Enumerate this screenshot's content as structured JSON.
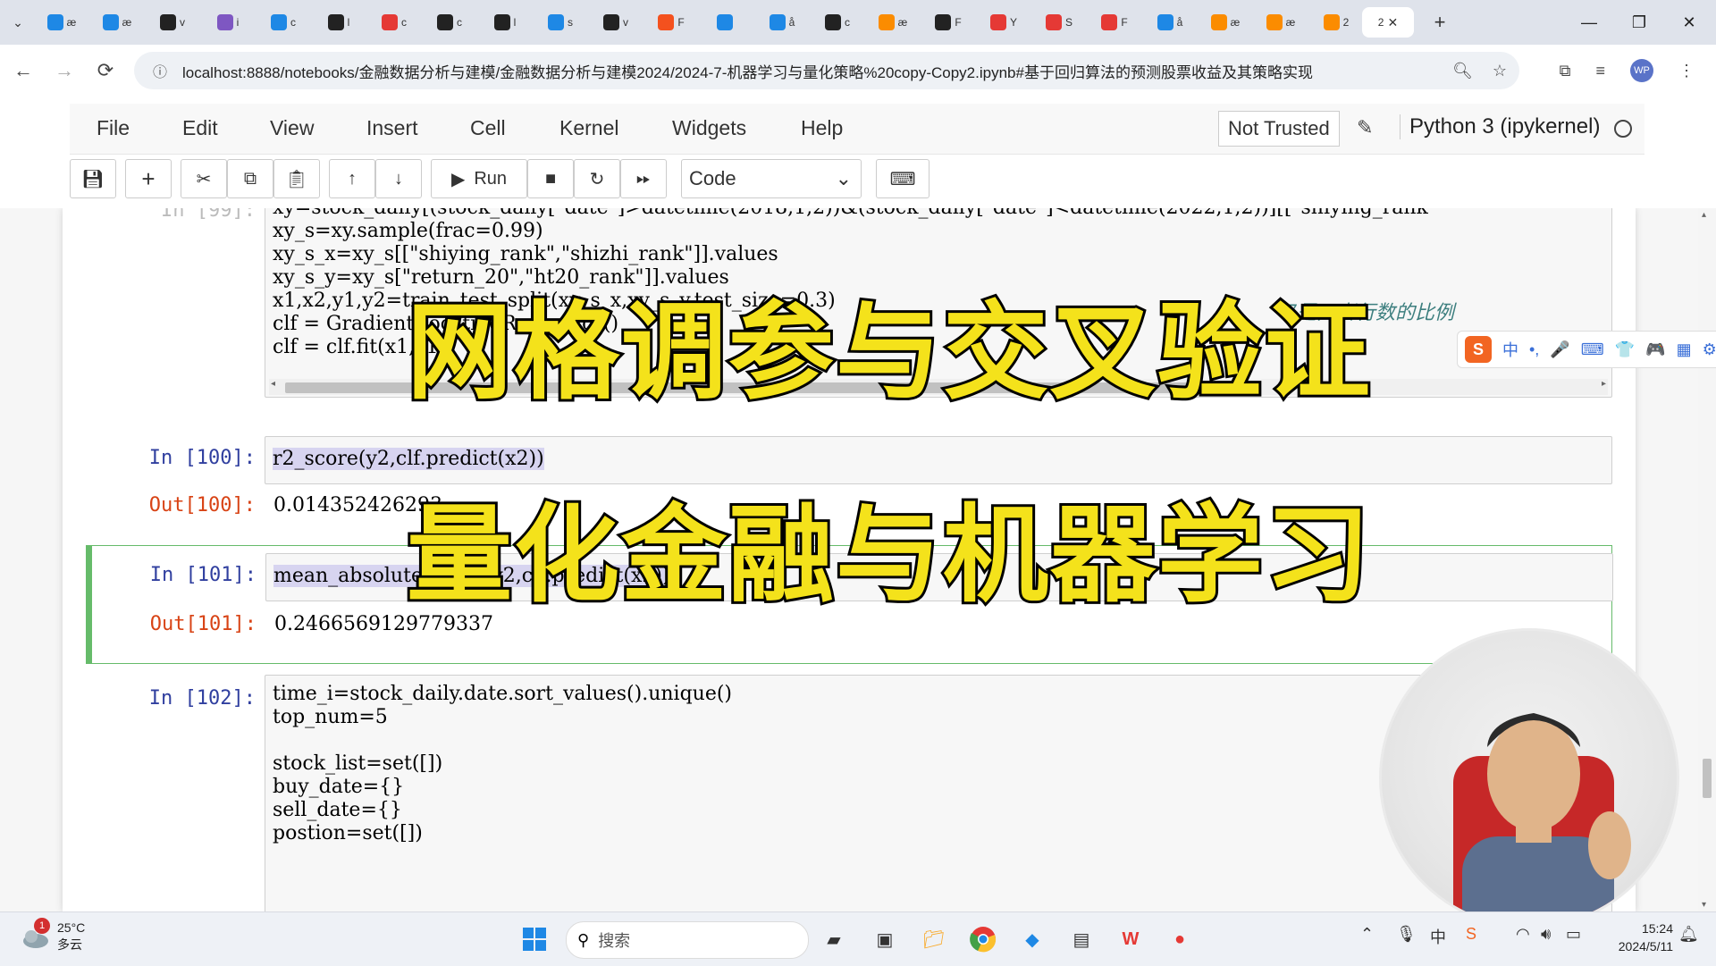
{
  "browser": {
    "active_tab_title": "2",
    "tab_close": "✕",
    "new_tab": "+",
    "tab_list": "⌄",
    "tabs": [
      {
        "label": "æ",
        "color": "#1e88e5",
        "icon": "bilibili-icon"
      },
      {
        "label": "æ",
        "color": "#1e88e5",
        "icon": "bilibili-icon"
      },
      {
        "label": "v",
        "color": "#222222",
        "icon": "github-icon"
      },
      {
        "label": "i",
        "color": "#7e57c2",
        "icon": "app-icon"
      },
      {
        "label": "c",
        "color": "#1e88e5",
        "icon": "translate-icon"
      },
      {
        "label": "l",
        "color": "#222222",
        "icon": "github-icon"
      },
      {
        "label": "c",
        "color": "#e53935",
        "icon": "cube-icon"
      },
      {
        "label": "c",
        "color": "#222222",
        "icon": "terminal-icon"
      },
      {
        "label": "l",
        "color": "#222222",
        "icon": "github-icon"
      },
      {
        "label": "s",
        "color": "#1e88e5",
        "icon": "zhihu-icon"
      },
      {
        "label": "v",
        "color": "#222222",
        "icon": "github-icon"
      },
      {
        "label": "F",
        "color": "#f4511e",
        "icon": "c-icon"
      },
      {
        "label": "",
        "color": "#1e88e5",
        "icon": "cloud-icon"
      },
      {
        "label": "å",
        "color": "#1e88e5",
        "icon": "cloud-icon"
      },
      {
        "label": "c",
        "color": "#222222",
        "icon": "github-icon"
      },
      {
        "label": "æ",
        "color": "#fb8c00",
        "icon": "jupyter-icon"
      },
      {
        "label": "F",
        "color": "#222222",
        "icon": "cap-icon"
      },
      {
        "label": "Y",
        "color": "#e53935",
        "icon": "youtube-icon"
      },
      {
        "label": "S",
        "color": "#e53935",
        "icon": "opera-icon"
      },
      {
        "label": "F",
        "color": "#e53935",
        "icon": "google-icon"
      },
      {
        "label": "å",
        "color": "#1e88e5",
        "icon": "bilibili-icon"
      },
      {
        "label": "æ",
        "color": "#fb8c00",
        "icon": "chart-icon"
      },
      {
        "label": "æ",
        "color": "#fb8c00",
        "icon": "jupyter-icon"
      },
      {
        "label": "2",
        "color": "#fb8c00",
        "icon": "doc-icon"
      }
    ],
    "url": "localhost:8888/notebooks/金融数据分析与建模/金融数据分析与建模2024/2024-7-机器学习与量化策略%20copy-Copy2.ipynb#基于回归算法的预测股票收益及其策略实现",
    "avatar_text": "WP",
    "window": {
      "minimize": "—",
      "maximize": "❐",
      "close": "✕"
    }
  },
  "jupyter": {
    "menu": [
      "File",
      "Edit",
      "View",
      "Insert",
      "Cell",
      "Kernel",
      "Widgets",
      "Help"
    ],
    "trust_status": "Not Trusted",
    "kernel_name": "Python 3 (ipykernel)",
    "run_label": "Run",
    "cell_type": "Code"
  },
  "cells": {
    "top_code_lines": [
      "xy=stock_daily[(stock_daily[\"date\"]>datetime(2018,1,2))&(stock_daily[\"date\"]<datetime(2022,1,2))][[\"shiying_rank",
      "xy_s=xy.sample(frac=0.99)",
      "xy_s_x=xy_s[[\"shiying_rank\",\"shizhi_rank\"]].values",
      "xy_s_y=xy_s[\"return_20\",\"ht20_rank\"]].values",
      "x1,x2,y1,y2=train_test_split(xy_s_x,xy_s_y,test_size=0.3)",
      "clf = GradientBoostingRegressor()",
      "clf = clf.fit(x1,y1)"
    ],
    "top_comment": "7是两者行数的比例",
    "c100_in": "In  [100]:",
    "c100_code": "r2_score(y2,clf.predict(x2))",
    "c100_out_prompt": "Out[100]:",
    "c100_out": "0.014352426293",
    "c101_in": "In  [101]:",
    "c101_code": "mean_absolute_error(y2,clf.predict(x2))",
    "c101_out_prompt": "Out[101]:",
    "c101_out": "0.2466569129779337",
    "c102_in": "In  [102]:",
    "c102_lines": [
      "time_i=stock_daily.date.sort_values().unique()",
      "top_num=5",
      "",
      "stock_list=set([])",
      "buy_date={}",
      "sell_date={}",
      "postion=set([])"
    ]
  },
  "overlay": {
    "title1": "网格调参与交叉验证",
    "title2": "量化金融与机器学习",
    "title_color": "#f4e21b"
  },
  "ime": {
    "logo": "S",
    "mode": "中",
    "items": [
      "•,",
      "🎤",
      "⌨",
      "👕",
      "🎮",
      "▦",
      "⚙"
    ]
  },
  "taskbar": {
    "weather_temp": "25°C",
    "weather_desc": "多云",
    "weather_badge": "1",
    "search_placeholder": "搜索",
    "time": "15:24",
    "date": "2024/5/11",
    "ime_lang": "中"
  }
}
